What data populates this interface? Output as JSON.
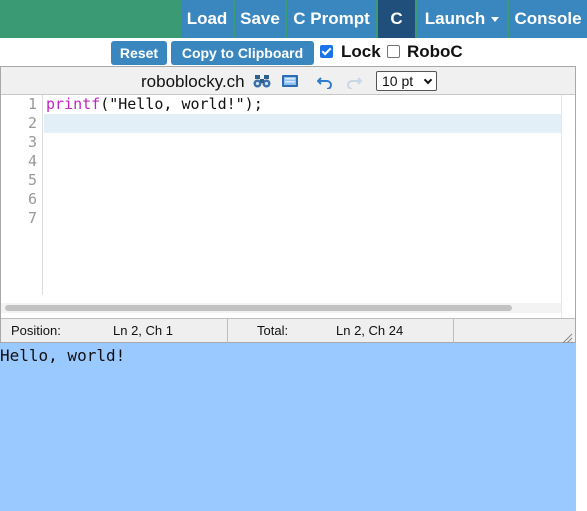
{
  "topbar": {
    "load": "Load",
    "save": "Save",
    "cprompt": "C Prompt",
    "c": "C",
    "launch": "Launch",
    "console": "Console"
  },
  "toolbar2": {
    "reset": "Reset",
    "copy": "Copy to Clipboard",
    "lock_label": "Lock",
    "lock_checked": true,
    "roboc_label": "RoboC",
    "roboc_checked": false
  },
  "editor": {
    "site": "roboblocky.ch",
    "font_size": "10 pt",
    "line_numbers": [
      "1",
      "2",
      "3",
      "4",
      "5",
      "6",
      "7"
    ],
    "code_fn": "printf",
    "code_rest": "(\"Hello, world!\");",
    "active_line": 2
  },
  "status": {
    "position_label": "Position:",
    "position_value": "Ln 2, Ch 1",
    "total_label": "Total:",
    "total_value": "Ln 2, Ch 24"
  },
  "console": {
    "output": "Hello, world!"
  },
  "icons": [
    "binoculars-icon",
    "display-icon",
    "undo-icon",
    "redo-icon",
    "resize-grip-icon"
  ],
  "colors": {
    "topbar_bg": "#3a9a74",
    "button_bg": "#3a87c0",
    "active_button_bg": "#1f4f7a",
    "console_bg": "#99c9ff",
    "keyword": "#c025c7"
  }
}
